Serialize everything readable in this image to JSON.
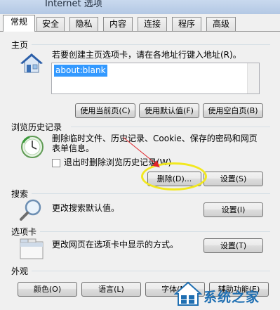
{
  "window": {
    "title": "Internet 选项"
  },
  "tabs": [
    {
      "label": "常规",
      "active": true
    },
    {
      "label": "安全"
    },
    {
      "label": "隐私"
    },
    {
      "label": "内容"
    },
    {
      "label": "连接"
    },
    {
      "label": "程序"
    },
    {
      "label": "高级"
    }
  ],
  "home": {
    "title": "主页",
    "description": "若要创建主页选项卡，请在各地址行键入地址(R)。",
    "url_value": "about:blank",
    "buttons": [
      "使用当前页(C)",
      "使用默认值(F)",
      "使用空白页(B)"
    ]
  },
  "history": {
    "title": "浏览历史记录",
    "description_line1": "删除临时文件、历史记录、Cookie、保存的密码和网页",
    "description_line2": "表单信息。",
    "checkbox_label": "退出时删除浏览历史记录(W)",
    "checkbox_checked": false,
    "delete_button": "删除(D)...",
    "settings_button": "设置(S)"
  },
  "search": {
    "title": "搜索",
    "description": "更改搜索默认值。",
    "settings_button": "设置(I)"
  },
  "tabs_section": {
    "title": "选项卡",
    "description": "更改网页在选项卡中显示的方式。",
    "settings_button": "设置(T)"
  },
  "appearance": {
    "title": "外观",
    "buttons": [
      "颜色(O)",
      "语言(L)",
      "字体(N)",
      "辅助功能(E)"
    ]
  },
  "watermark": {
    "text": "系统之家"
  },
  "colors": {
    "selection": "#3399ff",
    "annotation_arrow": "#e0242a",
    "annotation_circle": "#f2e81f"
  }
}
